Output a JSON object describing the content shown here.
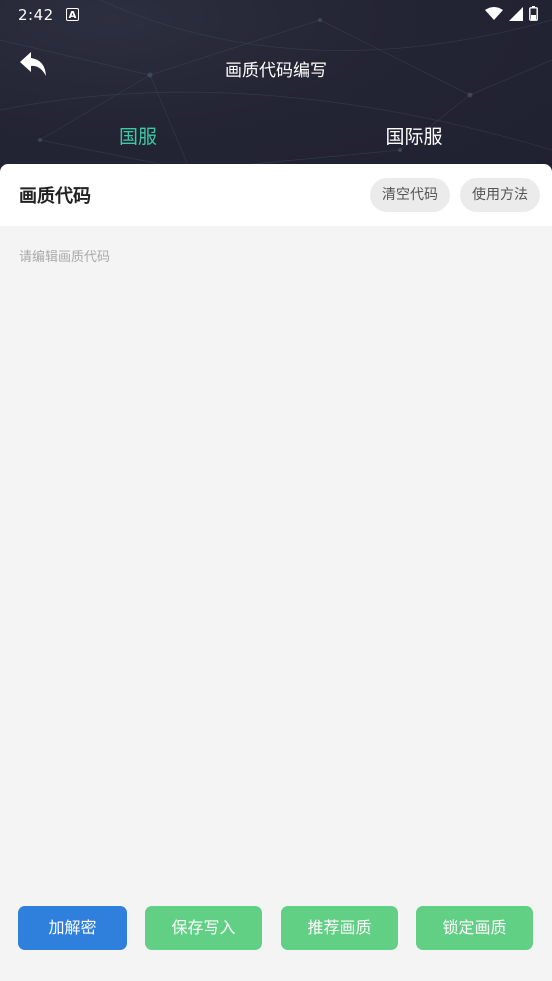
{
  "status_bar": {
    "time": "2:42",
    "notification_icon": "a-icon",
    "icons": [
      "wifi-icon",
      "signal-icon",
      "battery-icon"
    ]
  },
  "header": {
    "back_icon": "back-arrow-icon",
    "title": "画质代码编写"
  },
  "tabs": [
    {
      "label": "国服",
      "active": true
    },
    {
      "label": "国际服",
      "active": false
    }
  ],
  "card": {
    "title": "画质代码",
    "clear_label": "清空代码",
    "usage_label": "使用方法"
  },
  "editor": {
    "value": "",
    "placeholder": "请编辑画质代码"
  },
  "actions": {
    "decrypt_label": "加解密",
    "save_label": "保存写入",
    "recommend_label": "推荐画质",
    "lock_label": "锁定画质"
  },
  "colors": {
    "active_tab": "#3cc9a4",
    "primary_blue": "#2f7fdc",
    "action_green": "#61cf84",
    "header_bg": "#232434"
  }
}
